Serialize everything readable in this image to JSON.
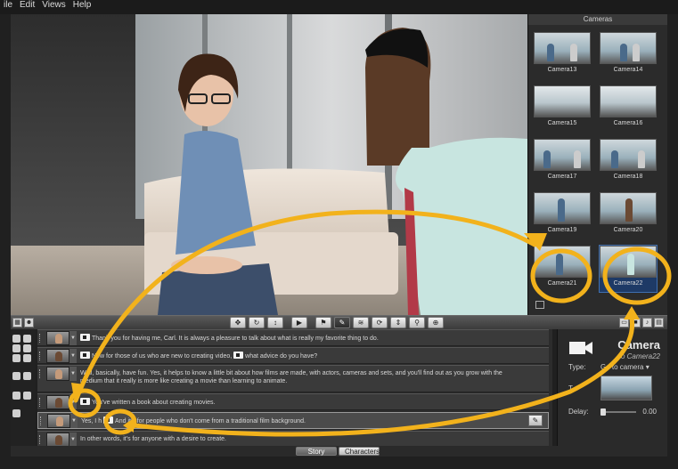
{
  "menu": {
    "items": [
      "ile",
      "Edit",
      "Views",
      "Help"
    ]
  },
  "cameras_panel": {
    "title": "Cameras",
    "cameras": [
      {
        "label": "Camera13"
      },
      {
        "label": "Camera14"
      },
      {
        "label": "Camera15"
      },
      {
        "label": "Camera16"
      },
      {
        "label": "Camera17"
      },
      {
        "label": "Camera18"
      },
      {
        "label": "Camera19"
      },
      {
        "label": "Camera20"
      },
      {
        "label": "Camera21"
      },
      {
        "label": "Camera22",
        "selected": true
      }
    ]
  },
  "story": {
    "lines": [
      {
        "text": "Thank you for having me, Carl. It is always a pleasure to talk about what is really my favorite thing to do.",
        "camera_chip": true
      },
      {
        "text_before": "Now for those of us who are new to creating video,",
        "text_after": "what advice do you have?",
        "camera_chip": true
      },
      {
        "text": "Well, basically, have fun. Yes, it helps to know a little bit about how films are made, with actors, cameras and sets, and you'll find out as you grow with the medium that it really is more like creating a movie than learning to animate.",
        "camera_chip": true
      },
      {
        "text": "You've written a book about creating movies.",
        "camera_chip": true
      },
      {
        "text_before": "Yes, I h",
        "text_after": "And it's for people who don't come from a traditional film background.",
        "camera_chip": true,
        "selected": true
      },
      {
        "text": "In other words, it's for anyone with a desire to create."
      }
    ]
  },
  "properties": {
    "title": "Camera",
    "subtitle": "to Camera22",
    "type_label": "Type:",
    "type_value": "Go to camera",
    "target_label": "T",
    "delay_label": "Delay:",
    "delay_value": "0.00",
    "delay_fraction": 0.0
  },
  "tabs": {
    "story": "Story",
    "characters": "Characters"
  },
  "colors": {
    "annotation": "#f2b21c",
    "selection": "#1e3a66"
  }
}
